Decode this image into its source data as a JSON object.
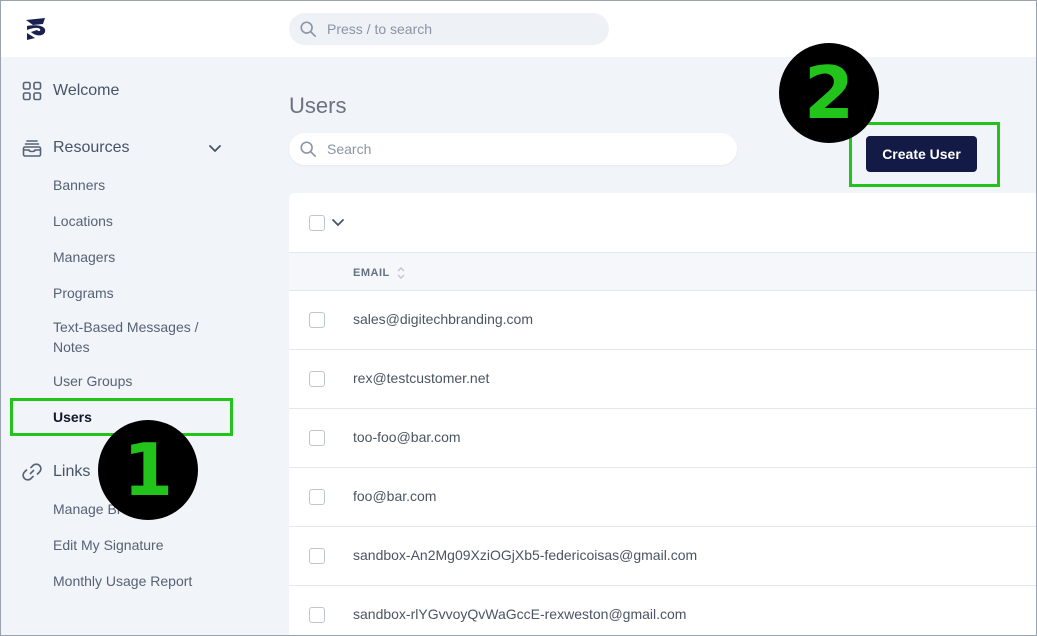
{
  "search": {
    "placeholder": "Press / to search"
  },
  "sidebar": {
    "welcome": "Welcome",
    "resources": "Resources",
    "resources_items": [
      "Banners",
      "Locations",
      "Managers",
      "Programs",
      "Text-Based Messages / Notes",
      "User Groups",
      "Users"
    ],
    "links": "Links",
    "links_items": [
      "Manage Br",
      "Edit My Signature",
      "Monthly Usage Report"
    ]
  },
  "main": {
    "title": "Users",
    "search_placeholder": "Search",
    "create_button": "Create User",
    "column_email": "EMAIL",
    "rows": [
      "sales@digitechbranding.com",
      "rex@testcustomer.net",
      "too-foo@bar.com",
      "foo@bar.com",
      "sandbox-An2Mg09XziOGjXb5-federicoisas@gmail.com",
      "sandbox-rlYGvvoyQvWaGccE-rexweston@gmail.com"
    ]
  },
  "annotations": {
    "marker_1": "1",
    "marker_2": "2"
  },
  "colors": {
    "primary": "#141a46",
    "highlight": "#22c31b",
    "sidebar_bg": "#f1f4f9"
  },
  "icons": {
    "welcome": "grid-icon",
    "resources": "inbox-stack-icon",
    "links": "link-icon",
    "search": "search-icon"
  }
}
